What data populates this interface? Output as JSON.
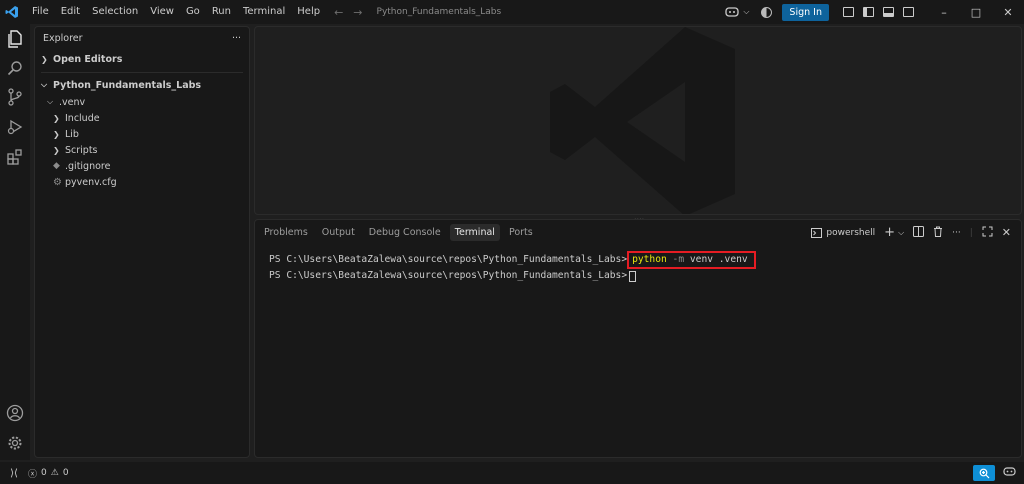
{
  "titlebar": {
    "menu": [
      "File",
      "Edit",
      "Selection",
      "View",
      "Go",
      "Run",
      "Terminal",
      "Help"
    ],
    "search_text": "Python_Fundamentals_Labs",
    "signin_label": "Sign In",
    "minimize": "–",
    "maximize": "□",
    "close": "✕"
  },
  "sidebar": {
    "title": "Explorer",
    "more": "···",
    "open_editors": "Open Editors",
    "project": "Python_Fundamentals_Labs",
    "items": [
      {
        "label": ".venv",
        "icon": "chevron-down"
      },
      {
        "label": "Include",
        "icon": "chevron-right"
      },
      {
        "label": "Lib",
        "icon": "chevron-right"
      },
      {
        "label": "Scripts",
        "icon": "chevron-right"
      },
      {
        "label": ".gitignore",
        "icon": "git-icon"
      },
      {
        "label": "pyvenv.cfg",
        "icon": "gear-icon"
      }
    ]
  },
  "panel": {
    "tabs": [
      "Problems",
      "Output",
      "Debug Console",
      "Terminal",
      "Ports"
    ],
    "active_tab": "Terminal",
    "shell": "powershell",
    "terminal": {
      "prompt": "PS C:\\Users\\BeataZalewa\\source\\repos\\Python_Fundamentals_Labs>",
      "cmd_python": "python",
      "cmd_flag": "-m",
      "cmd_rest": "venv .venv"
    }
  },
  "statusbar": {
    "errors": "0",
    "warnings": "0"
  },
  "colors": {
    "accent": "#0e639c",
    "highlight_box": "#e51c23",
    "command_yellow": "#e5e510",
    "zoom_btn": "#0e8fd6"
  }
}
